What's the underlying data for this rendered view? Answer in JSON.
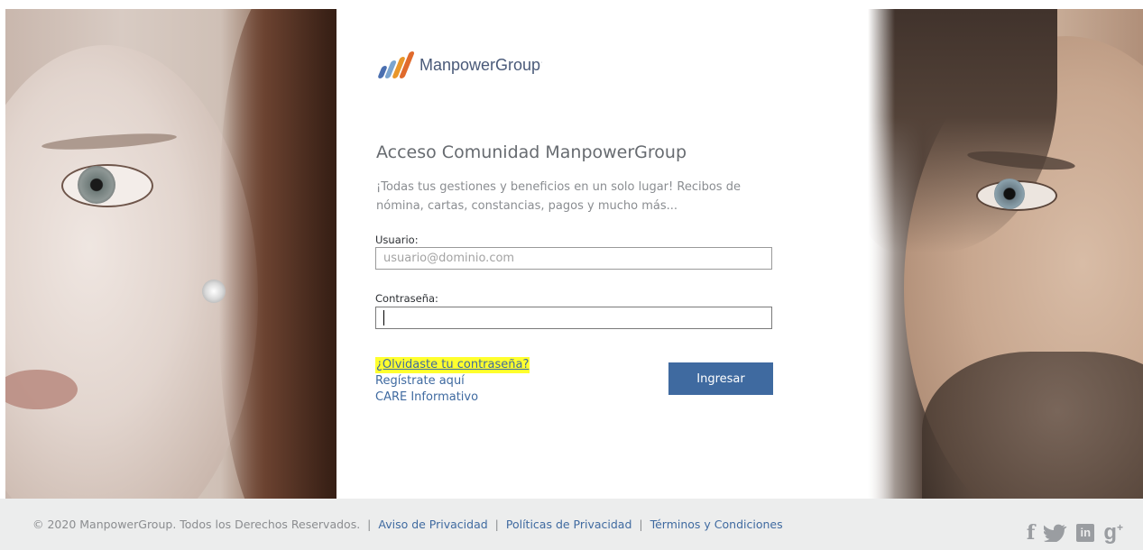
{
  "brand": {
    "logo_name": "ManpowerGroup",
    "logo_mark": "·",
    "colors": {
      "bar1": "#4a6fb0",
      "bar2": "#7aa4cf",
      "bar3": "#e8962a",
      "bar4": "#e06a2c"
    }
  },
  "login": {
    "title": "Acceso Comunidad ManpowerGroup",
    "description": "¡Todas tus gestiones y beneficios en un solo lugar! Recibos de nómina, cartas, constancias, pagos y mucho más...",
    "username_label": "Usuario:",
    "username_placeholder": "usuario@dominio.com",
    "username_value": "",
    "password_label": "Contraseña:",
    "password_value": "",
    "forgot_link": "¿Olvidaste tu contraseña?",
    "register_link": "Regístrate aquí",
    "care_link": "CARE Informativo",
    "submit_label": "Ingresar"
  },
  "footer": {
    "copyright": "© 2020 ManpowerGroup. Todos los Derechos Reservados.",
    "separator": "|",
    "links": [
      "Aviso de Privacidad",
      "Políticas de Privacidad",
      "Términos y Condiciones"
    ],
    "social": [
      "facebook-icon",
      "twitter-icon",
      "linkedin-icon",
      "googleplus-icon"
    ]
  }
}
